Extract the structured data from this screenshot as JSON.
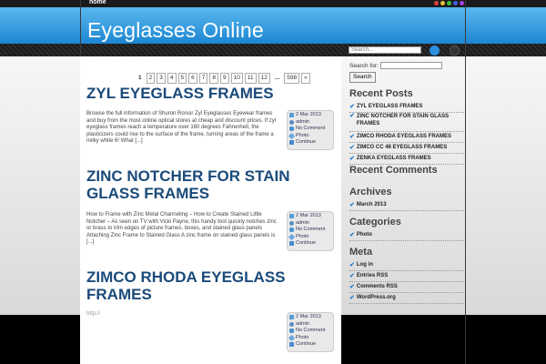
{
  "topbar": {
    "home_label": "home"
  },
  "header": {
    "site_title": "Eyeglasses Online",
    "search_placeholder": "Search..."
  },
  "pagination": [
    "1",
    "2",
    "3",
    "4",
    "5",
    "6",
    "7",
    "8",
    "9",
    "10",
    "11",
    "12",
    "...",
    "598",
    "»"
  ],
  "posts": [
    {
      "title": "ZYL EYEGLASS FRAMES",
      "excerpt": "Browse the full information of Shuron Ronsir Zyl Eyeglasses Eyewear frames and buy from the most online optical stores at cheap and discount prices. If zyl eyeglass frames reach a temperature over 160 degrees Fahrenheit, the plasticizers could rise to the surface of the frame, turning areas of the frame a milky white 6! What [...]",
      "date": "2 Mar 2013",
      "author": "admin",
      "comments": "No Comment",
      "category": "Photo",
      "more": "Continue"
    },
    {
      "title": "ZINC NOTCHER FOR STAIN GLASS FRAMES",
      "excerpt": "How to Frame with Zinc Metal Channeling – How to Create Stained Little Notcher – As seen on TV with Vicki Payne, this handy tool quickly notches zinc or brass to trim edges of picture frames, boxes, and stained glass panels Attaching Zinc Frame to Stained Glass A zinc frame on stained glass panels is [...]",
      "date": "2 Mar 2013",
      "author": "admin",
      "comments": "No Comment",
      "category": "Photo",
      "more": "Continue"
    },
    {
      "title": "ZIMCO RHODA EYEGLASS FRAMES",
      "excerpt": "http://",
      "date": "2 Mar 2013",
      "author": "admin",
      "comments": "No Comment",
      "category": "Photo",
      "more": "Continue"
    }
  ],
  "sidebar": {
    "search_label": "Search for:",
    "search_button": "Search",
    "recent_posts_title": "Recent Posts",
    "recent_posts": [
      "ZYL EYEGLASS FRAMES",
      "ZINC NOTCHER FOR STAIN GLASS FRAMES",
      "ZIMCO RHODA EYEGLASS FRAMES",
      "ZIMCO CC 48 EYEGLASS FRAMES",
      "ZENKA EYEGLASS FRAMES"
    ],
    "recent_comments_title": "Recent Comments",
    "archives_title": "Archives",
    "archives": [
      "March 2013"
    ],
    "categories_title": "Categories",
    "categories": [
      "Photo"
    ],
    "meta_title": "Meta",
    "meta": [
      "Log in",
      "Entries RSS",
      "Comments RSS",
      "WordPress.org"
    ]
  },
  "colors": {
    "header_blue": "#2a94dc",
    "title_blue": "#1a4a7a"
  }
}
